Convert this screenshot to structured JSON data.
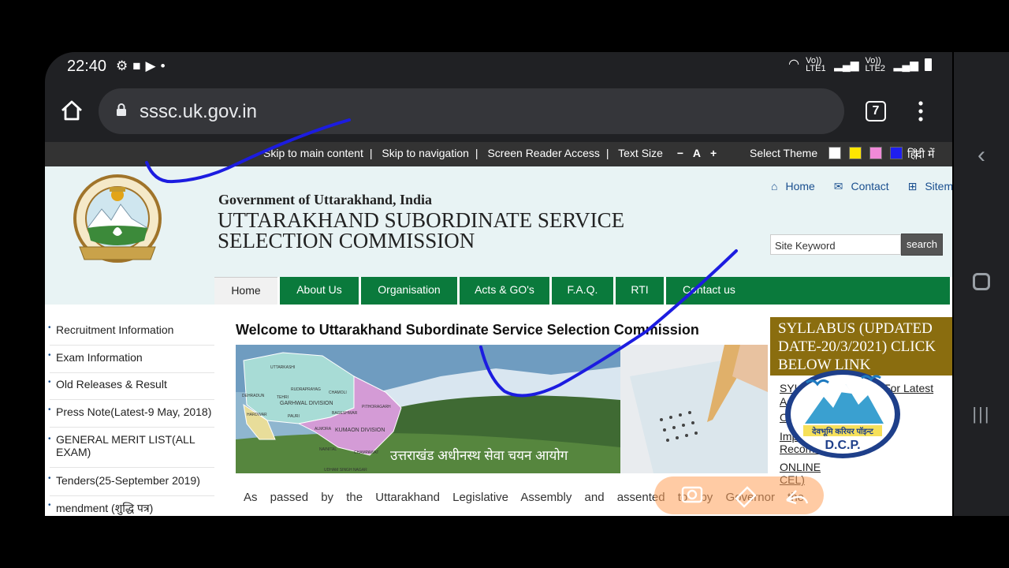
{
  "status_bar": {
    "time": "22:40",
    "net1": "Vo)) LTE1",
    "net2": "Vo)) LTE2"
  },
  "browser": {
    "url": "sssc.uk.gov.in",
    "tab_count": "7"
  },
  "accessibility_bar": {
    "links": [
      "Skip to main content",
      "Skip to navigation",
      "Screen Reader Access",
      "Text Size"
    ],
    "text_size_controls": [
      "−",
      "A",
      "+"
    ],
    "theme_label": "Select Theme",
    "theme_colors": [
      "#ffffff",
      "#ffe600",
      "#f08ad8",
      "#1f1ff0"
    ],
    "language": "हिंदी में"
  },
  "header": {
    "gov": "Government of Uttarakhand, India",
    "org_line1": "UTTARAKHAND SUBORDINATE SERVICE",
    "org_line2": "SELECTION COMMISSION",
    "links": [
      "Home",
      "Contact",
      "Sitemap"
    ],
    "search_placeholder": "Site Keyword",
    "search_button": "search"
  },
  "main_nav": [
    "Home",
    "About Us",
    "Organisation",
    "Acts & GO's",
    "F.A.Q.",
    "RTI",
    "Contact us"
  ],
  "sidebar": [
    "Recruitment Information",
    "Exam Information",
    "Old Releases & Result",
    "Press Note(Latest-9 May, 2018)",
    "GENERAL MERIT LIST(ALL EXAM)",
    "Tenders(25-September 2019)",
    "mendment (शुद्धि पत्र)"
  ],
  "content": {
    "welcome": "Welcome to Uttarakhand Subordinate Service Selection Commission",
    "banner_text": "उत्तराखंड अधीनस्थ सेवा चयन आयोग",
    "paragraph": "As passed by the Uttarakhand Legislative Assembly and assented to by Governor the",
    "map_labels": [
      "UTTARKASHI",
      "TEHRI",
      "RUDRAPRAYAG",
      "CHAMOLI",
      "DEHRADUN",
      "GARHWAL DIVISION",
      "PAURI",
      "HARDWAR",
      "PITHORAGARH",
      "BAGESHWAR",
      "ALMORA",
      "KUMAON DIVISION",
      "NAINITAL",
      "CHAMPAWAT",
      "UDHAM SINGH NAGAR"
    ]
  },
  "right_column": {
    "syllabus_heading": "SYLLABUS (UPDATED DATE-20/3/2021) CLICK BELOW LINK",
    "links": [
      "SYLLABUS(पाठ्यक्रम) For Latest Advt.(Da",
      "OLD QUE",
      "Importa",
      "Recomm",
      "ONLINE",
      "CEL)"
    ]
  },
  "watermark": {
    "hindi": "देवभूमि करियर पॉइन्ट",
    "abbr": "D.C.P."
  },
  "colors": {
    "nav_green": "#0a7a3c",
    "syllabus_bg": "#8a6d0f",
    "header_bg": "#e8f3f4",
    "link_blue": "#1a4f8f"
  }
}
